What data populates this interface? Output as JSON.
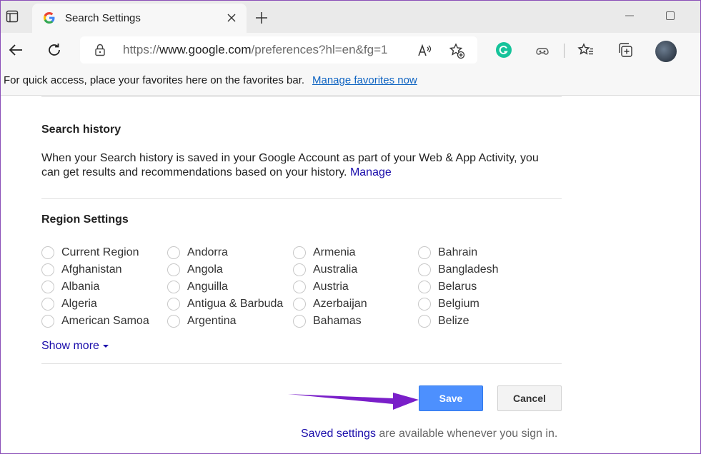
{
  "browser": {
    "tab": {
      "title": "Search Settings"
    },
    "address_bar": {
      "url_prefix": "https://",
      "url_host": "www.google.com",
      "url_rest": "/preferences?hl=en&fg=1"
    },
    "favorites_bar": {
      "message": "For quick access, place your favorites here on the favorites bar.",
      "link": "Manage favorites now"
    }
  },
  "search_history": {
    "heading": "Search history",
    "text": "When your Search history is saved in your Google Account as part of your Web & App Activity, you can get results and recommendations based on your history.",
    "manage_link": "Manage"
  },
  "region_settings": {
    "heading": "Region Settings",
    "columns": [
      [
        "Current Region",
        "Afghanistan",
        "Albania",
        "Algeria",
        "American Samoa"
      ],
      [
        "Andorra",
        "Angola",
        "Anguilla",
        "Antigua & Barbuda",
        "Argentina"
      ],
      [
        "Armenia",
        "Australia",
        "Austria",
        "Azerbaijan",
        "Bahamas"
      ],
      [
        "Bahrain",
        "Bangladesh",
        "Belarus",
        "Belgium",
        "Belize"
      ]
    ],
    "show_more": "Show more"
  },
  "actions": {
    "save": "Save",
    "cancel": "Cancel"
  },
  "footer": {
    "saved_link": "Saved settings",
    "rest": " are available whenever you sign in."
  },
  "colors": {
    "annotation_arrow": "#7a1fc9",
    "save_button": "#4d90fe",
    "link": "#1a0dab"
  }
}
